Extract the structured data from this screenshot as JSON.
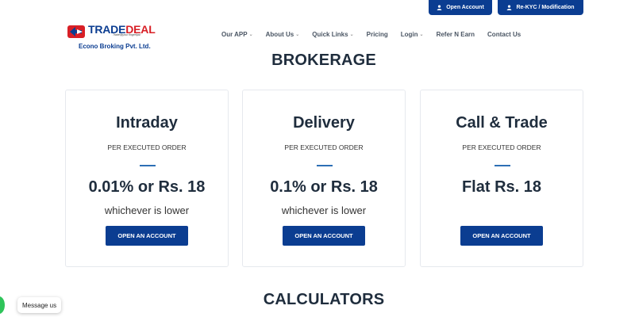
{
  "top_actions": {
    "open_account": "Open Account",
    "rekyc": "Re-KYC / Modification"
  },
  "logo": {
    "brand_trade": "TRADE",
    "brand_deal": "DEAL",
    "tagline": "Trade@your fingertips!",
    "company": "Econo Broking Pvt. Ltd."
  },
  "nav": {
    "items": [
      {
        "label": "Our APP",
        "has_dropdown": true
      },
      {
        "label": "About Us",
        "has_dropdown": true
      },
      {
        "label": "Quick Links",
        "has_dropdown": true
      },
      {
        "label": "Pricing",
        "has_dropdown": false
      },
      {
        "label": "Login",
        "has_dropdown": true
      },
      {
        "label": "Refer N Earn",
        "has_dropdown": false
      },
      {
        "label": "Contact Us",
        "has_dropdown": false
      }
    ],
    "chevron": "⌄"
  },
  "brokerage": {
    "title": "BROKERAGE",
    "cards": [
      {
        "title": "Intraday",
        "subtitle": "PER EXECUTED ORDER",
        "price": "0.01% or Rs. 18",
        "note": "whichever is lower",
        "button": "OPEN AN ACCOUNT"
      },
      {
        "title": "Delivery",
        "subtitle": "PER EXECUTED ORDER",
        "price": "0.1% or Rs. 18",
        "note": "whichever is lower",
        "button": "OPEN AN ACCOUNT"
      },
      {
        "title": "Call & Trade",
        "subtitle": "PER EXECUTED ORDER",
        "price": "Flat Rs. 18",
        "note": "",
        "button": "OPEN AN ACCOUNT"
      }
    ]
  },
  "calculators": {
    "title": "CALCULATORS"
  },
  "chat": {
    "label": "Message us",
    "icon": "whatsapp-icon",
    "color": "#2fc45a"
  },
  "colors": {
    "primary": "#0b3d91",
    "brand_red": "#d81f26",
    "heading": "#1f2d3d"
  }
}
